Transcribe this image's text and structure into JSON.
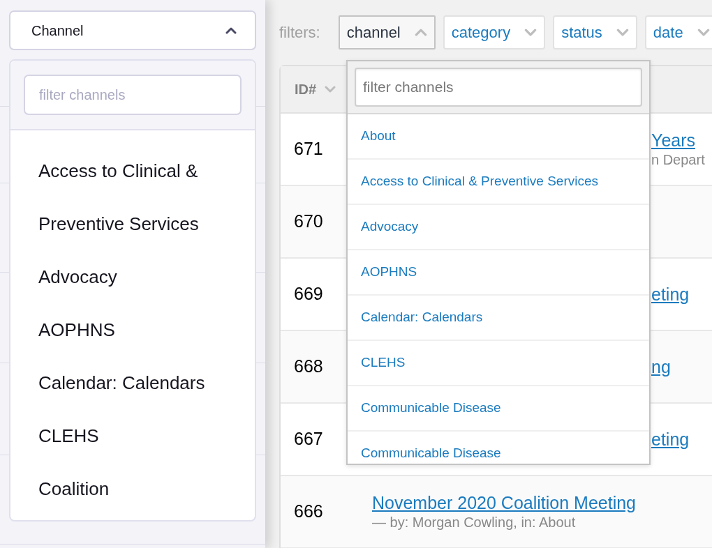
{
  "mockup": {
    "select": {
      "label": "Channel",
      "expanded": true
    },
    "search": {
      "placeholder": "filter channels"
    },
    "items": [
      "Access to Clinical & Preventive Services",
      "Advocacy",
      "AOPHNS",
      "Calendar: Calendars",
      "CLEHS",
      "Coalition"
    ]
  },
  "filters_label": "filters:",
  "filters": [
    {
      "label": "channel",
      "selected": true
    },
    {
      "label": "category",
      "selected": false
    },
    {
      "label": "status",
      "selected": false
    },
    {
      "label": "date",
      "selected": false
    }
  ],
  "dropdown": {
    "search": {
      "placeholder": "filter channels"
    },
    "items": [
      "About",
      "Access to Clinical & Preventive Services",
      "Advocacy",
      "AOPHNS",
      "Calendar: Calendars",
      "CLEHS",
      "Communicable Disease",
      "Communicable Disease"
    ]
  },
  "table": {
    "columns": [
      "ID#"
    ],
    "rows": [
      {
        "id": "671",
        "kind": "partial",
        "title": "Years",
        "subtitle": "n Depart"
      },
      {
        "id": "670",
        "kind": "partial"
      },
      {
        "id": "669",
        "kind": "partial",
        "title": "eting"
      },
      {
        "id": "668",
        "kind": "partial",
        "title": "ng"
      },
      {
        "id": "667",
        "kind": "partial",
        "title": "eting"
      },
      {
        "id": "666",
        "kind": "full",
        "title": "November 2020 Coalition Meeting",
        "subtitle": "— by: Morgan Cowling, in: About"
      }
    ]
  }
}
